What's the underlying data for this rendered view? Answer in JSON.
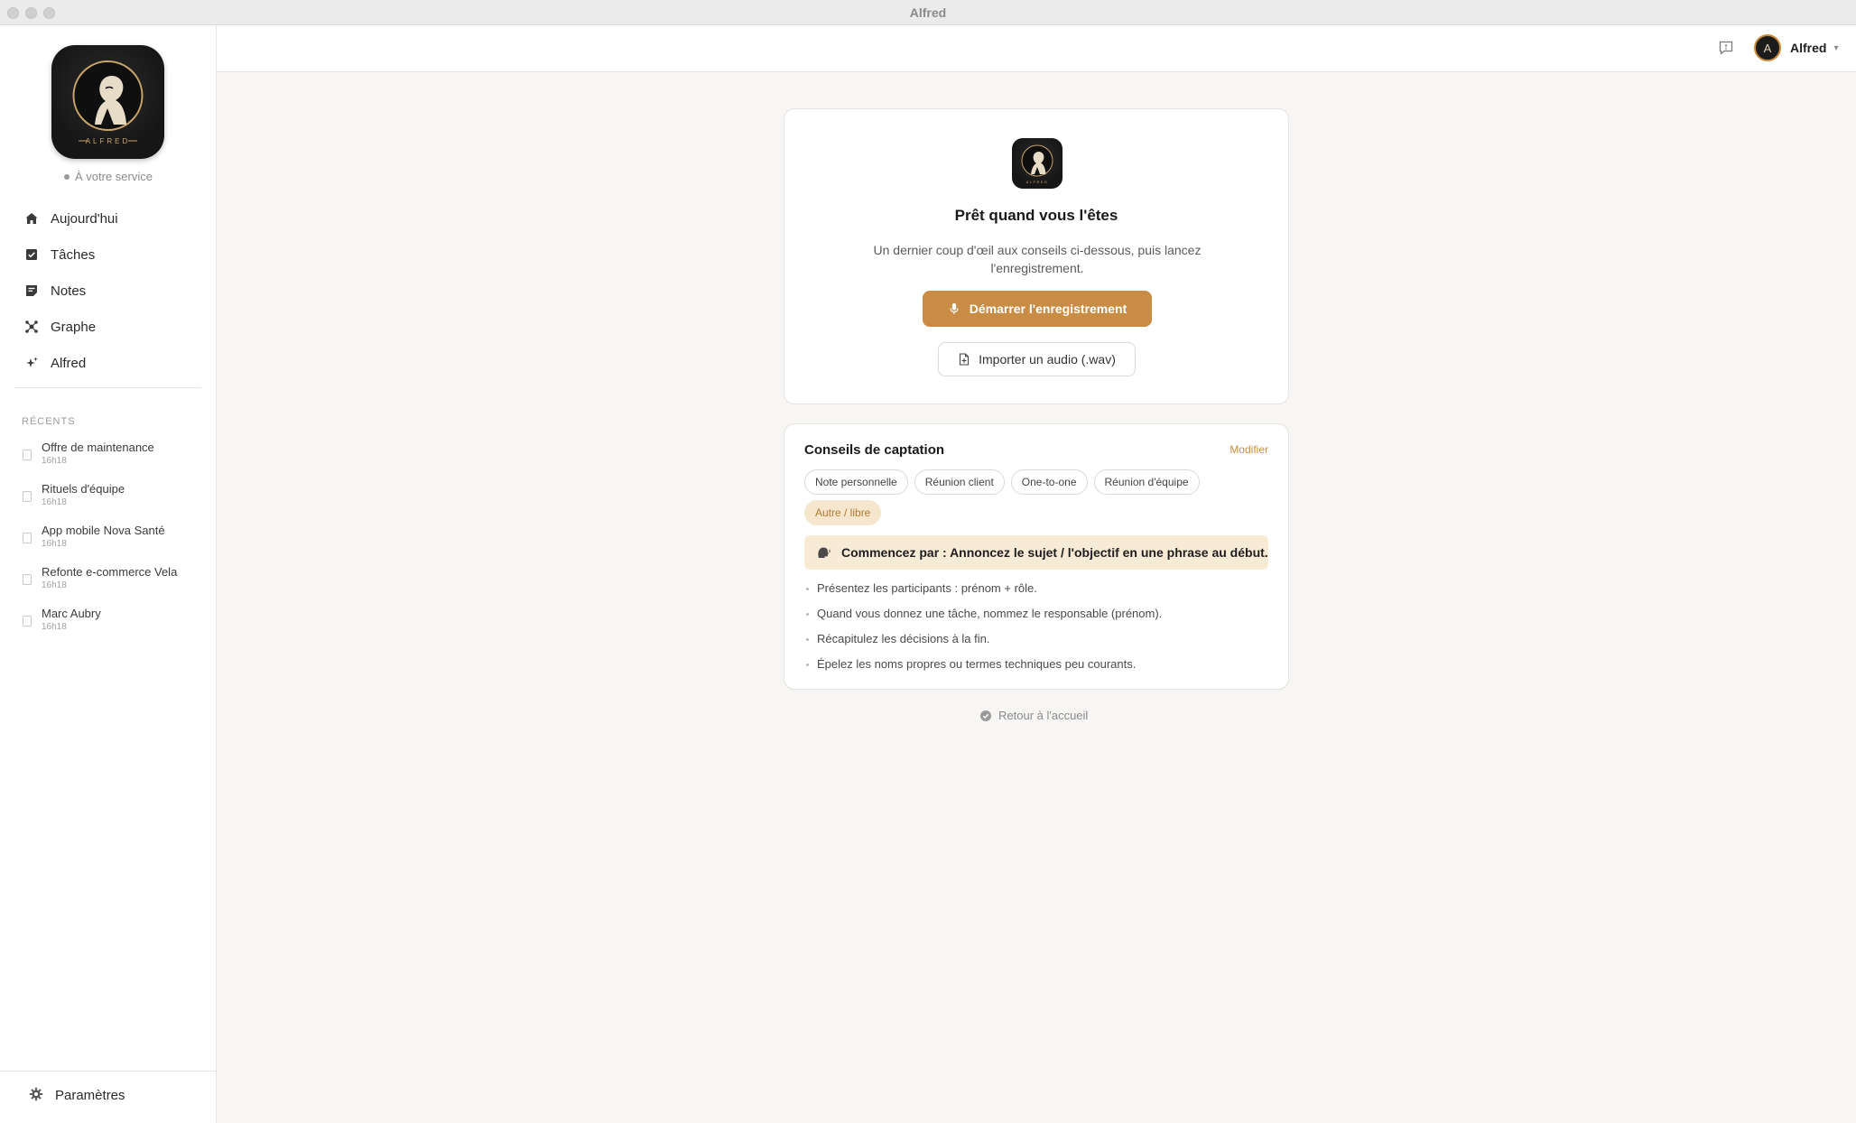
{
  "window": {
    "title": "Alfred"
  },
  "sidebar": {
    "logo_text": "ALFRED",
    "status": "À votre service",
    "nav": [
      {
        "label": "Aujourd'hui",
        "icon": "home-icon"
      },
      {
        "label": "Tâches",
        "icon": "checkbox-icon"
      },
      {
        "label": "Notes",
        "icon": "note-icon"
      },
      {
        "label": "Graphe",
        "icon": "graph-icon"
      },
      {
        "label": "Alfred",
        "icon": "sparkle-icon"
      }
    ],
    "recents_label": "RÉCENTS",
    "recents": [
      {
        "title": "Offre de maintenance",
        "time": "16h18"
      },
      {
        "title": "Rituels d'équipe",
        "time": "16h18"
      },
      {
        "title": "App mobile Nova Santé",
        "time": "16h18"
      },
      {
        "title": "Refonte e-commerce Vela",
        "time": "16h18"
      },
      {
        "title": "Marc Aubry",
        "time": "16h18"
      }
    ],
    "settings_label": "Paramètres"
  },
  "topbar": {
    "user_initial": "A",
    "user_name": "Alfred"
  },
  "ready_card": {
    "logo_text": "ALFRED",
    "title": "Prêt quand vous l'êtes",
    "description": "Un dernier coup d'œil aux conseils ci-dessous, puis lancez l'enregistrement.",
    "start_button": "Démarrer l'enregistrement",
    "import_button": "Importer un audio (.wav)"
  },
  "tips_card": {
    "title": "Conseils de captation",
    "edit_label": "Modifier",
    "chips": [
      {
        "label": "Note personnelle",
        "active": false
      },
      {
        "label": "Réunion client",
        "active": false
      },
      {
        "label": "One-to-one",
        "active": false
      },
      {
        "label": "Réunion d'équipe",
        "active": false
      },
      {
        "label": "Autre / libre",
        "active": true
      }
    ],
    "highlight": "Commencez par : Annoncez le sujet / l'objectif en une phrase au début.",
    "tips": [
      "Présentez les participants : prénom + rôle.",
      "Quand vous donnez une tâche, nommez le responsable (prénom).",
      "Récapitulez les décisions à la fin.",
      "Épelez les noms propres ou termes techniques peu courants."
    ]
  },
  "back_link": "Retour à l'accueil",
  "colors": {
    "accent": "#c98c44",
    "accent_soft": "#f8ebd6",
    "background": "#f7f6f4"
  }
}
